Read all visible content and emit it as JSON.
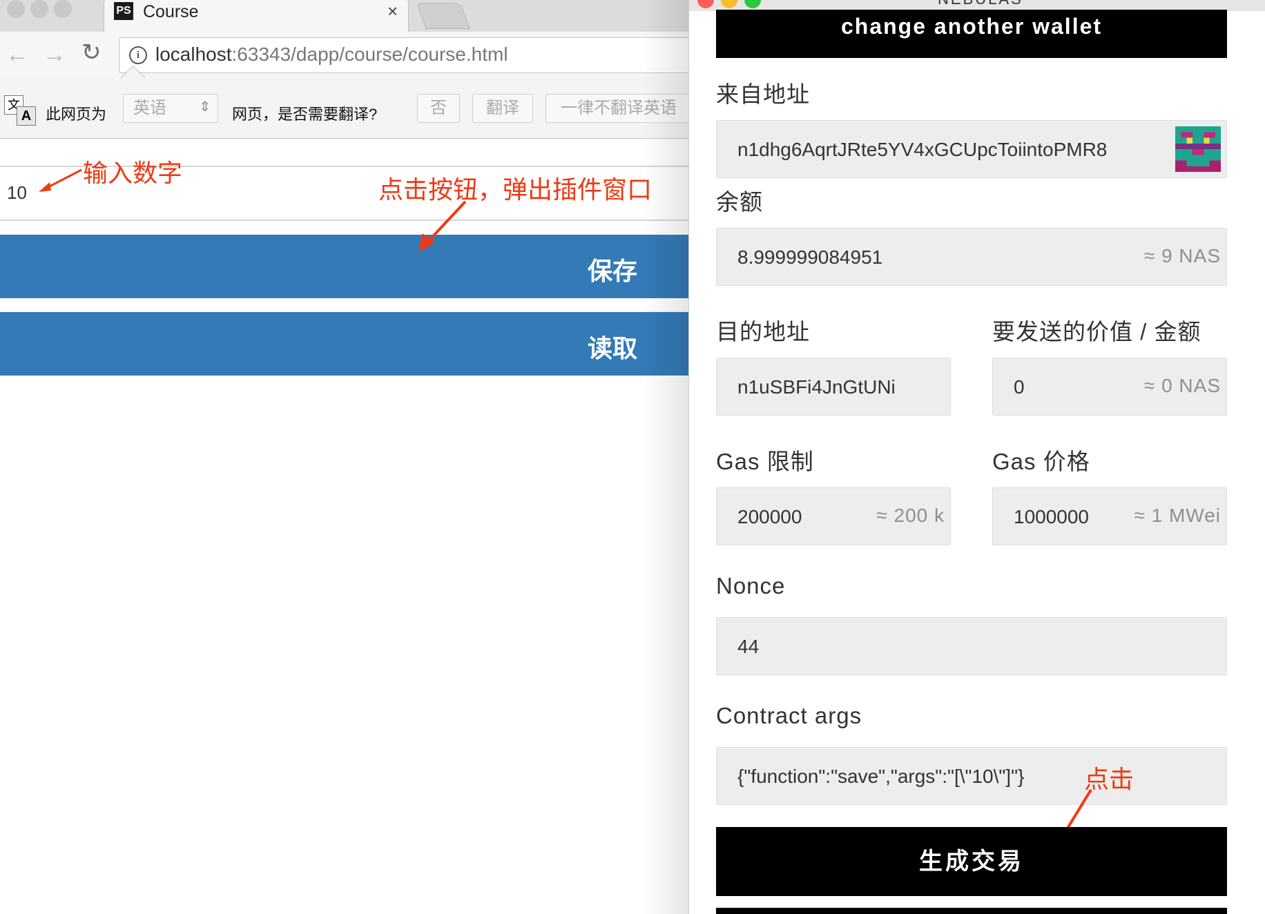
{
  "browser": {
    "tab": {
      "icon_text": "PS",
      "title": "Course",
      "close": "×"
    },
    "nav": {
      "back": "←",
      "forward": "→",
      "reload": "↻"
    },
    "address": {
      "host": "localhost",
      "path": ":63343/dapp/course/course.html"
    },
    "translate_bar": {
      "icon_glyph": "文",
      "icon_letter": "A",
      "lead_text": "此网页为",
      "language_select": "英语",
      "question": "网页，是否需要翻译?",
      "no_button": "否",
      "translate_button": "翻译",
      "never_button": "一律不翻译英语"
    },
    "page": {
      "number_input_value": "10",
      "save_button": "保存",
      "read_button": "读取"
    },
    "annotations": {
      "input_number": "输入数字",
      "click_button": "点击按钮，弹出插件窗口"
    }
  },
  "popup": {
    "window_title": "NEBULAS",
    "change_wallet_button": "change another wallet",
    "from_address": {
      "label": "来自地址",
      "value": "n1dhg6AqrtJRte5YV4xGCUpcToiintoPMR8"
    },
    "balance": {
      "label": "余额",
      "value": "8.999999084951",
      "hint": "≈ 9 NAS"
    },
    "to_address": {
      "label": "目的地址",
      "value": "n1uSBFi4JnGtUNi"
    },
    "amount": {
      "label": "要发送的价值 / 金额",
      "value": "0",
      "hint": "≈ 0 NAS"
    },
    "gas_limit": {
      "label": "Gas 限制",
      "value": "200000",
      "hint": "≈ 200 k"
    },
    "gas_price": {
      "label": "Gas 价格",
      "value": "1000000",
      "hint": "≈ 1 MWei"
    },
    "nonce": {
      "label": "Nonce",
      "value": "44"
    },
    "contract_args": {
      "label": "Contract args",
      "value": "{\"function\":\"save\",\"args\":\"[\\\"10\\\"]\"}"
    },
    "generate_button": "生成交易",
    "annotation_click": "点击"
  },
  "colors": {
    "primary_button": "#337ab7",
    "annotation": "#ee3a14",
    "popup_button": "#000000",
    "field_bg": "#ededed"
  }
}
